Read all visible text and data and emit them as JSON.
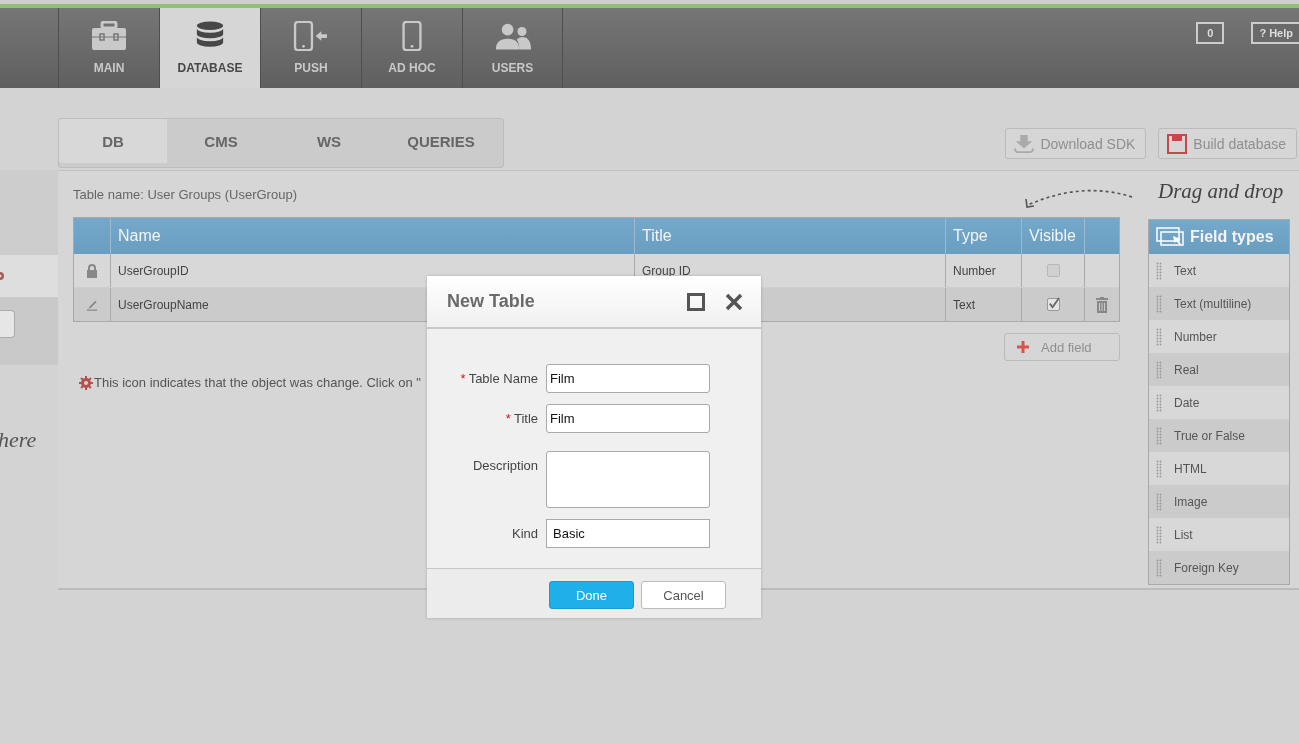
{
  "nav_tabs": [
    {
      "label": "MAIN",
      "selected": false
    },
    {
      "label": "DATABASE",
      "selected": true
    },
    {
      "label": "PUSH",
      "selected": false
    },
    {
      "label": "AD HOC",
      "selected": false
    },
    {
      "label": "USERS",
      "selected": false
    }
  ],
  "header_actions": {
    "comments_count": "0",
    "help": "? Help"
  },
  "sidebar": {
    "hint": "here"
  },
  "sub_tabs": [
    {
      "label": "DB",
      "selected": true
    },
    {
      "label": "CMS",
      "selected": false
    },
    {
      "label": "WS",
      "selected": false
    },
    {
      "label": "QUERIES",
      "selected": false
    }
  ],
  "toolbar": [
    {
      "label": "Download SDK",
      "kind": "download"
    },
    {
      "label": "Build database",
      "kind": "save"
    }
  ],
  "table_name": "Table name: User Groups (UserGroup)",
  "drag_hint": "Drag and drop",
  "table": {
    "columns": [
      "Name",
      "Title",
      "Type",
      "Visible"
    ],
    "rows": [
      {
        "kind": "locked",
        "name": "UserGroupID",
        "title": "Group ID",
        "type": "Number",
        "visible": false,
        "selected": false
      },
      {
        "kind": "editable",
        "name": "UserGroupName",
        "type": "Text",
        "visible": true,
        "selected": true
      }
    ]
  },
  "add_field": "Add field",
  "legend": "This icon indicates that the object was change. Click on \"",
  "field_types": {
    "title": "Field types",
    "items": [
      "Text",
      "Text (multiline)",
      "Number",
      "Real",
      "Date",
      "True or False",
      "HTML",
      "Image",
      "List",
      "Foreign Key"
    ]
  },
  "dialog": {
    "title": "New Table",
    "fields": [
      {
        "label": "Table Name",
        "marker": "*",
        "kind": "text",
        "value": "Film"
      },
      {
        "label": "Title",
        "marker": "*",
        "kind": "text",
        "value": "Film"
      },
      {
        "label": "Description",
        "kind": "textarea"
      },
      {
        "label": "Kind",
        "kind": "text",
        "value": "Basic"
      }
    ],
    "buttons": [
      {
        "label": "Done",
        "kind": "primary"
      },
      {
        "label": "Cancel",
        "kind": "secondary"
      }
    ]
  }
}
